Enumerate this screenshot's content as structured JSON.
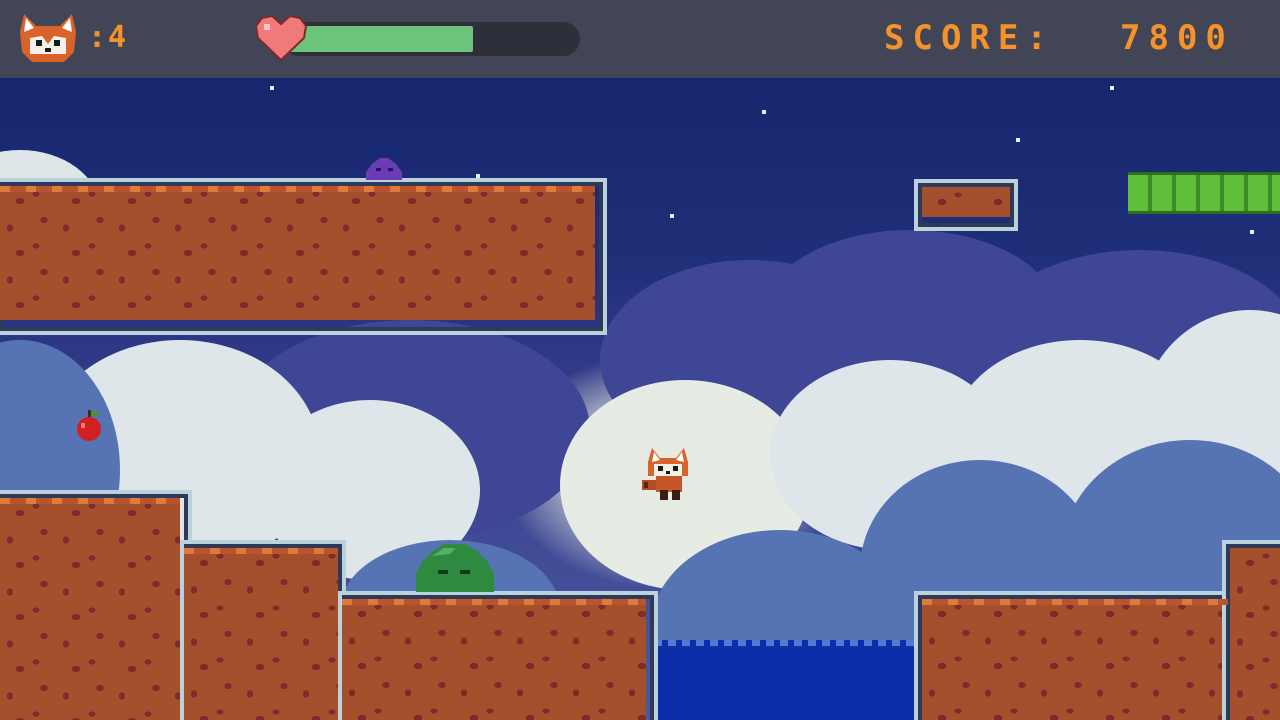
{
  "hud": {
    "lives_icon": "red-panda-face-icon",
    "lives_text": ":4",
    "heart_icon": "heart-icon",
    "health_fraction": 0.64,
    "score_label": "SCORE:",
    "score_value": "7800"
  },
  "colors": {
    "hud_background": "#424556",
    "hud_text": "#f5922a",
    "health_bar": "#6cc37a",
    "dirt": "#a5502d",
    "platform_border": "#b9d2dc",
    "water": "#0d2ea8",
    "sky": "#14226a"
  },
  "entities": {
    "player": "red-panda-icon",
    "enemy_green": "green-slime-icon",
    "enemy_purple": "purple-slime-icon",
    "pickup": "apple-icon",
    "bamboo": "bamboo-platform"
  }
}
